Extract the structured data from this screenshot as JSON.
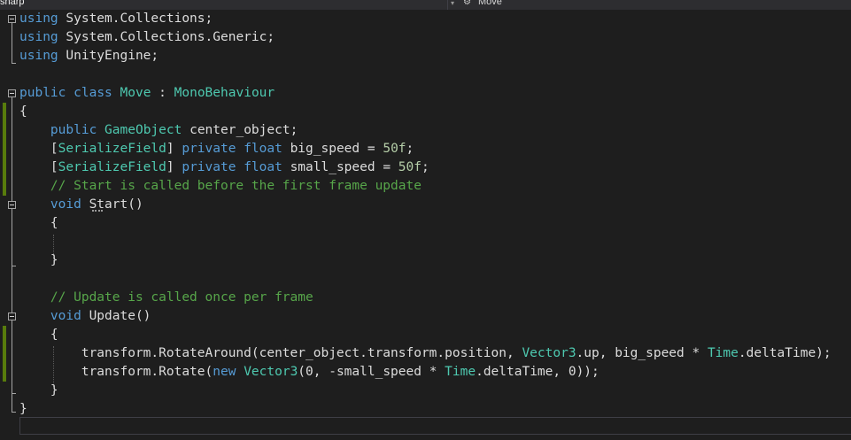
{
  "navbar": {
    "project_label": "sharp",
    "member_label": "Move",
    "member_icon": "class-icon"
  },
  "code_lines": [
    [
      {
        "t": "using",
        "c": "kw"
      },
      {
        "t": " System.Collections;",
        "c": ""
      }
    ],
    [
      {
        "t": "using",
        "c": "kw"
      },
      {
        "t": " System.Collections.Generic;",
        "c": ""
      }
    ],
    [
      {
        "t": "using",
        "c": "kw"
      },
      {
        "t": " UnityEngine;",
        "c": ""
      }
    ],
    [],
    [
      {
        "t": "public",
        "c": "kw"
      },
      {
        "t": " ",
        "c": ""
      },
      {
        "t": "class",
        "c": "kw"
      },
      {
        "t": " ",
        "c": ""
      },
      {
        "t": "Move",
        "c": "ty"
      },
      {
        "t": " : ",
        "c": ""
      },
      {
        "t": "MonoBehaviour",
        "c": "ty"
      }
    ],
    [
      {
        "t": "{",
        "c": ""
      }
    ],
    [
      {
        "t": "    ",
        "c": ""
      },
      {
        "t": "public",
        "c": "kw"
      },
      {
        "t": " ",
        "c": ""
      },
      {
        "t": "GameObject",
        "c": "ty"
      },
      {
        "t": " center_object;",
        "c": ""
      }
    ],
    [
      {
        "t": "    [",
        "c": ""
      },
      {
        "t": "SerializeField",
        "c": "ty"
      },
      {
        "t": "] ",
        "c": ""
      },
      {
        "t": "private",
        "c": "kw"
      },
      {
        "t": " ",
        "c": ""
      },
      {
        "t": "float",
        "c": "kw"
      },
      {
        "t": " big_speed = ",
        "c": ""
      },
      {
        "t": "50f",
        "c": "nm"
      },
      {
        "t": ";",
        "c": ""
      }
    ],
    [
      {
        "t": "    [",
        "c": ""
      },
      {
        "t": "SerializeField",
        "c": "ty"
      },
      {
        "t": "] ",
        "c": ""
      },
      {
        "t": "private",
        "c": "kw"
      },
      {
        "t": " ",
        "c": ""
      },
      {
        "t": "float",
        "c": "kw"
      },
      {
        "t": " small_speed = ",
        "c": ""
      },
      {
        "t": "50f",
        "c": "nm"
      },
      {
        "t": ";",
        "c": ""
      }
    ],
    [
      {
        "t": "    // Start is called before the first frame update",
        "c": "cm"
      }
    ],
    [
      {
        "t": "    ",
        "c": ""
      },
      {
        "t": "void",
        "c": "kw"
      },
      {
        "t": " Start()",
        "c": ""
      }
    ],
    [
      {
        "t": "    {",
        "c": ""
      }
    ],
    [],
    [
      {
        "t": "    }",
        "c": ""
      }
    ],
    [],
    [
      {
        "t": "    // Update is called once per frame",
        "c": "cm"
      }
    ],
    [
      {
        "t": "    ",
        "c": ""
      },
      {
        "t": "void",
        "c": "kw"
      },
      {
        "t": " Update()",
        "c": ""
      }
    ],
    [
      {
        "t": "    {",
        "c": ""
      }
    ],
    [
      {
        "t": "        transform.RotateAround(center_object.transform.position, ",
        "c": ""
      },
      {
        "t": "Vector3",
        "c": "ty"
      },
      {
        "t": ".up, big_speed * ",
        "c": ""
      },
      {
        "t": "Time",
        "c": "ty"
      },
      {
        "t": ".deltaTime);",
        "c": ""
      }
    ],
    [
      {
        "t": "        transform.Rotate(",
        "c": ""
      },
      {
        "t": "new",
        "c": "kw"
      },
      {
        "t": " ",
        "c": ""
      },
      {
        "t": "Vector3",
        "c": "ty"
      },
      {
        "t": "(0, -small_speed * ",
        "c": ""
      },
      {
        "t": "Time",
        "c": "ty"
      },
      {
        "t": ".deltaTime, 0));",
        "c": ""
      }
    ],
    [
      {
        "t": "    }",
        "c": ""
      }
    ],
    [
      {
        "t": "}",
        "c": ""
      }
    ]
  ],
  "colors": {
    "background": "#1e1e1e",
    "keyword": "#569cd6",
    "type": "#4ec9b0",
    "comment": "#57a64a",
    "number": "#b5cea8",
    "text": "#dcdcdc",
    "change_bar": "#587c0c"
  }
}
